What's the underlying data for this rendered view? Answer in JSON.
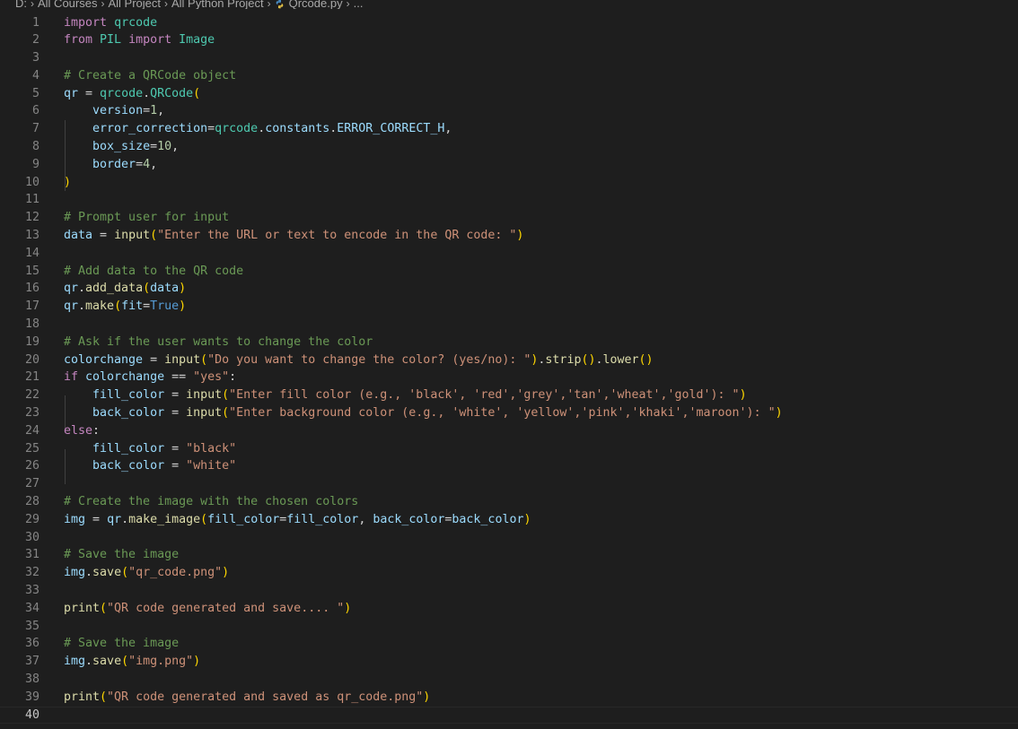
{
  "breadcrumb": {
    "segments": [
      "D:",
      "All Courses",
      "All Project",
      "All Python Project",
      "Qrcode.py",
      "..."
    ],
    "file_icon": "python-file-icon"
  },
  "editor": {
    "current_line": 40,
    "lines": [
      {
        "n": "1",
        "t": [
          [
            "kw",
            "import"
          ],
          [
            "op",
            " "
          ],
          [
            "mod",
            "qrcode"
          ]
        ]
      },
      {
        "n": "2",
        "t": [
          [
            "kw",
            "from"
          ],
          [
            "op",
            " "
          ],
          [
            "mod",
            "PIL"
          ],
          [
            "op",
            " "
          ],
          [
            "kw",
            "import"
          ],
          [
            "op",
            " "
          ],
          [
            "mod",
            "Image"
          ]
        ]
      },
      {
        "n": "3",
        "t": []
      },
      {
        "n": "4",
        "t": [
          [
            "cmt",
            "# Create a QRCode object"
          ]
        ]
      },
      {
        "n": "5",
        "t": [
          [
            "var",
            "qr"
          ],
          [
            "op",
            " = "
          ],
          [
            "mod",
            "qrcode"
          ],
          [
            "op",
            "."
          ],
          [
            "mod",
            "QRCode"
          ],
          [
            "p1",
            "("
          ]
        ]
      },
      {
        "n": "6",
        "t": [
          [
            "op",
            "    "
          ],
          [
            "var",
            "version"
          ],
          [
            "op",
            "="
          ],
          [
            "num",
            "1"
          ],
          [
            "op",
            ","
          ]
        ]
      },
      {
        "n": "7",
        "t": [
          [
            "op",
            "    "
          ],
          [
            "var",
            "error_correction"
          ],
          [
            "op",
            "="
          ],
          [
            "mod",
            "qrcode"
          ],
          [
            "op",
            "."
          ],
          [
            "var",
            "constants"
          ],
          [
            "op",
            "."
          ],
          [
            "var",
            "ERROR_CORRECT_H"
          ],
          [
            "op",
            ","
          ]
        ]
      },
      {
        "n": "8",
        "t": [
          [
            "op",
            "    "
          ],
          [
            "var",
            "box_size"
          ],
          [
            "op",
            "="
          ],
          [
            "num",
            "10"
          ],
          [
            "op",
            ","
          ]
        ]
      },
      {
        "n": "9",
        "t": [
          [
            "op",
            "    "
          ],
          [
            "var",
            "border"
          ],
          [
            "op",
            "="
          ],
          [
            "num",
            "4"
          ],
          [
            "op",
            ","
          ]
        ]
      },
      {
        "n": "10",
        "t": [
          [
            "p1",
            ")"
          ]
        ]
      },
      {
        "n": "11",
        "t": []
      },
      {
        "n": "12",
        "t": [
          [
            "cmt",
            "# Prompt user for input"
          ]
        ]
      },
      {
        "n": "13",
        "t": [
          [
            "var",
            "data"
          ],
          [
            "op",
            " = "
          ],
          [
            "fn",
            "input"
          ],
          [
            "p1",
            "("
          ],
          [
            "str",
            "\"Enter the URL or text to encode in the QR code: \""
          ],
          [
            "p1",
            ")"
          ]
        ]
      },
      {
        "n": "14",
        "t": []
      },
      {
        "n": "15",
        "t": [
          [
            "cmt",
            "# Add data to the QR code"
          ]
        ]
      },
      {
        "n": "16",
        "t": [
          [
            "var",
            "qr"
          ],
          [
            "op",
            "."
          ],
          [
            "fn",
            "add_data"
          ],
          [
            "p1",
            "("
          ],
          [
            "var",
            "data"
          ],
          [
            "p1",
            ")"
          ]
        ]
      },
      {
        "n": "17",
        "t": [
          [
            "var",
            "qr"
          ],
          [
            "op",
            "."
          ],
          [
            "fn",
            "make"
          ],
          [
            "p1",
            "("
          ],
          [
            "var",
            "fit"
          ],
          [
            "op",
            "="
          ],
          [
            "kw2",
            "True"
          ],
          [
            "p1",
            ")"
          ]
        ]
      },
      {
        "n": "18",
        "t": []
      },
      {
        "n": "19",
        "t": [
          [
            "cmt",
            "# Ask if the user wants to change the color"
          ]
        ]
      },
      {
        "n": "20",
        "t": [
          [
            "var",
            "colorchange"
          ],
          [
            "op",
            " = "
          ],
          [
            "fn",
            "input"
          ],
          [
            "p1",
            "("
          ],
          [
            "str",
            "\"Do you want to change the color? (yes/no): \""
          ],
          [
            "p1",
            ")"
          ],
          [
            "op",
            "."
          ],
          [
            "fn",
            "strip"
          ],
          [
            "p1",
            "()"
          ],
          [
            "op",
            "."
          ],
          [
            "fn",
            "lower"
          ],
          [
            "p1",
            "()"
          ]
        ]
      },
      {
        "n": "21",
        "t": [
          [
            "kw",
            "if"
          ],
          [
            "op",
            " "
          ],
          [
            "var",
            "colorchange"
          ],
          [
            "op",
            " == "
          ],
          [
            "str",
            "\"yes\""
          ],
          [
            "op",
            ":"
          ]
        ]
      },
      {
        "n": "22",
        "t": [
          [
            "op",
            "    "
          ],
          [
            "var",
            "fill_color"
          ],
          [
            "op",
            " = "
          ],
          [
            "fn",
            "input"
          ],
          [
            "p1",
            "("
          ],
          [
            "str",
            "\"Enter fill color (e.g., 'black', 'red','grey','tan','wheat','gold'): \""
          ],
          [
            "p1",
            ")"
          ]
        ]
      },
      {
        "n": "23",
        "t": [
          [
            "op",
            "    "
          ],
          [
            "var",
            "back_color"
          ],
          [
            "op",
            " = "
          ],
          [
            "fn",
            "input"
          ],
          [
            "p1",
            "("
          ],
          [
            "str",
            "\"Enter background color (e.g., 'white', 'yellow','pink','khaki','maroon'): \""
          ],
          [
            "p1",
            ")"
          ]
        ]
      },
      {
        "n": "24",
        "t": [
          [
            "kw",
            "else"
          ],
          [
            "op",
            ":"
          ]
        ]
      },
      {
        "n": "25",
        "t": [
          [
            "op",
            "    "
          ],
          [
            "var",
            "fill_color"
          ],
          [
            "op",
            " = "
          ],
          [
            "str",
            "\"black\""
          ]
        ]
      },
      {
        "n": "26",
        "t": [
          [
            "op",
            "    "
          ],
          [
            "var",
            "back_color"
          ],
          [
            "op",
            " = "
          ],
          [
            "str",
            "\"white\""
          ]
        ]
      },
      {
        "n": "27",
        "t": []
      },
      {
        "n": "28",
        "t": [
          [
            "cmt",
            "# Create the image with the chosen colors"
          ]
        ]
      },
      {
        "n": "29",
        "t": [
          [
            "var",
            "img"
          ],
          [
            "op",
            " = "
          ],
          [
            "var",
            "qr"
          ],
          [
            "op",
            "."
          ],
          [
            "fn",
            "make_image"
          ],
          [
            "p1",
            "("
          ],
          [
            "var",
            "fill_color"
          ],
          [
            "op",
            "="
          ],
          [
            "var",
            "fill_color"
          ],
          [
            "op",
            ", "
          ],
          [
            "var",
            "back_color"
          ],
          [
            "op",
            "="
          ],
          [
            "var",
            "back_color"
          ],
          [
            "p1",
            ")"
          ]
        ]
      },
      {
        "n": "30",
        "t": []
      },
      {
        "n": "31",
        "t": [
          [
            "cmt",
            "# Save the image"
          ]
        ]
      },
      {
        "n": "32",
        "t": [
          [
            "var",
            "img"
          ],
          [
            "op",
            "."
          ],
          [
            "fn",
            "save"
          ],
          [
            "p1",
            "("
          ],
          [
            "str",
            "\"qr_code.png\""
          ],
          [
            "p1",
            ")"
          ]
        ]
      },
      {
        "n": "33",
        "t": []
      },
      {
        "n": "34",
        "t": [
          [
            "fn",
            "print"
          ],
          [
            "p1",
            "("
          ],
          [
            "str",
            "\"QR code generated and save.... \""
          ],
          [
            "p1",
            ")"
          ]
        ]
      },
      {
        "n": "35",
        "t": []
      },
      {
        "n": "36",
        "t": [
          [
            "cmt",
            "# Save the image"
          ]
        ]
      },
      {
        "n": "37",
        "t": [
          [
            "var",
            "img"
          ],
          [
            "op",
            "."
          ],
          [
            "fn",
            "save"
          ],
          [
            "p1",
            "("
          ],
          [
            "str",
            "\"img.png\""
          ],
          [
            "p1",
            ")"
          ]
        ]
      },
      {
        "n": "38",
        "t": []
      },
      {
        "n": "39",
        "t": [
          [
            "fn",
            "print"
          ],
          [
            "p1",
            "("
          ],
          [
            "str",
            "\"QR code generated and saved as qr_code.png\""
          ],
          [
            "p1",
            ")"
          ]
        ]
      },
      {
        "n": "40",
        "t": []
      }
    ]
  },
  "colors": {
    "background": "#1e1e1e",
    "keyword": "#c586c0",
    "module": "#4ec9b0",
    "variable": "#9cdcfe",
    "function": "#dcdcaa",
    "string": "#ce9178",
    "number": "#b5cea8",
    "comment": "#6a9955",
    "bracket": "#ffd700"
  }
}
